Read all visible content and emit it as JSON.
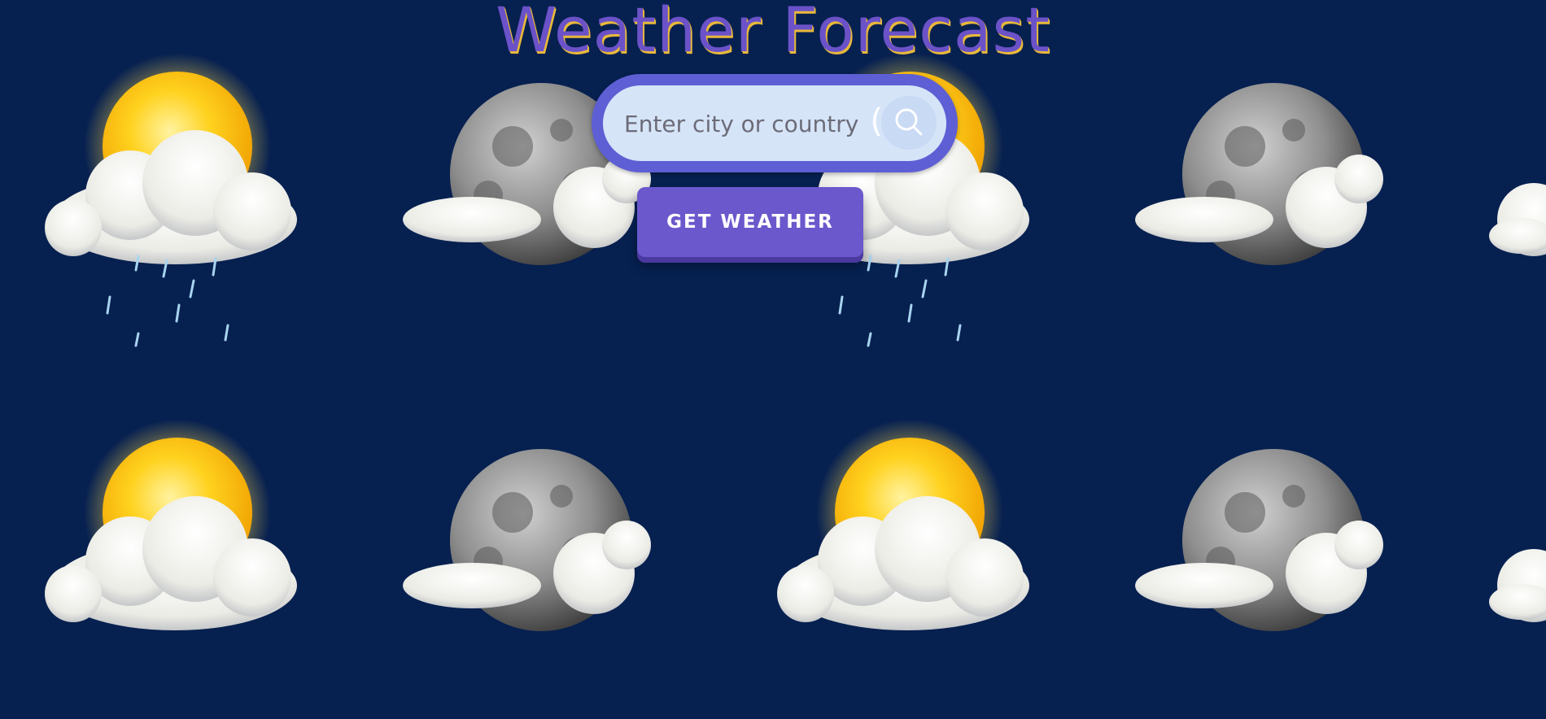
{
  "header": {
    "title": "Weather Forecast"
  },
  "search": {
    "placeholder": "Enter city or country",
    "value": "",
    "icon": "search-icon"
  },
  "actions": {
    "get_weather_label": "GET WEATHER"
  },
  "background": {
    "pattern": [
      "sun-cloud-rain-icon",
      "moon-cloud-icon",
      "sun-cloud-rain-icon",
      "moon-cloud-icon",
      "cloud-icon"
    ],
    "colors": {
      "sky": "#062050",
      "sun": "#ffc21a",
      "moon": "#8a8a8a",
      "cloud": "#f2f2ee",
      "accent": "#6a58cc"
    }
  }
}
